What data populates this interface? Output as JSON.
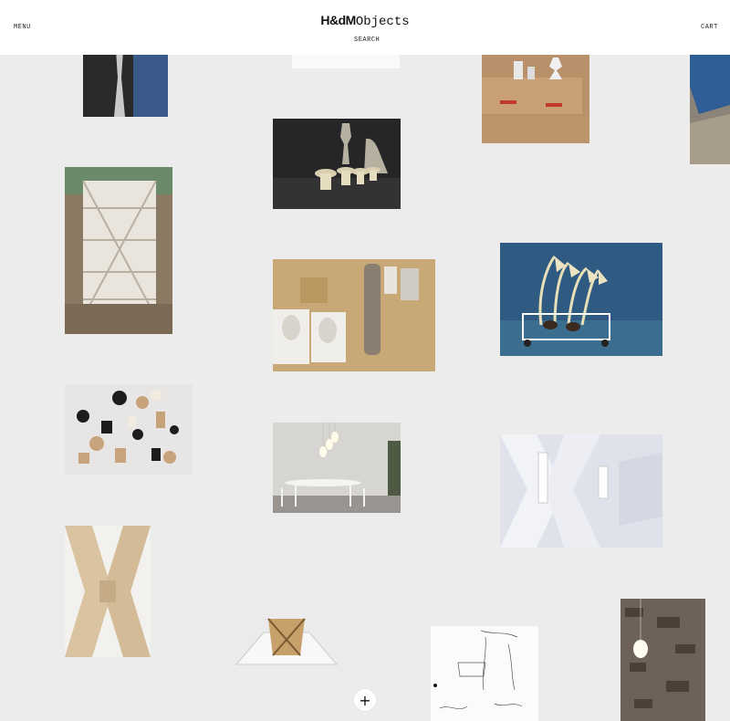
{
  "header": {
    "menu_label": "MENU",
    "logo_bold": "H&dM",
    "logo_light": "Objects",
    "search_label": "SEARCH",
    "cart_label": "CART"
  },
  "grid": {
    "tiles": [
      {
        "name": "tile-column-photo",
        "icon": "photo-column"
      },
      {
        "name": "tile-white-object",
        "icon": "photo-white"
      },
      {
        "name": "tile-cardboard-boxes",
        "icon": "photo-boxes"
      },
      {
        "name": "tile-blue-edge",
        "icon": "photo-blue"
      },
      {
        "name": "tile-mushroom-stools",
        "icon": "photo-stools"
      },
      {
        "name": "tile-stacked-structure",
        "icon": "photo-structure"
      },
      {
        "name": "tile-molds-workshop",
        "icon": "photo-molds"
      },
      {
        "name": "tile-lamp-trolley",
        "icon": "photo-lamps"
      },
      {
        "name": "tile-game-pieces",
        "icon": "photo-pieces"
      },
      {
        "name": "tile-pendant-table",
        "icon": "photo-table"
      },
      {
        "name": "tile-white-x-interior",
        "icon": "photo-x-interior"
      },
      {
        "name": "tile-wooden-x",
        "icon": "photo-wood-x"
      },
      {
        "name": "tile-folded-model",
        "icon": "photo-model"
      },
      {
        "name": "tile-sketch",
        "icon": "photo-sketch"
      },
      {
        "name": "tile-wall-lamp",
        "icon": "photo-wall-lamp"
      }
    ]
  },
  "load_more": {
    "label": "+"
  }
}
